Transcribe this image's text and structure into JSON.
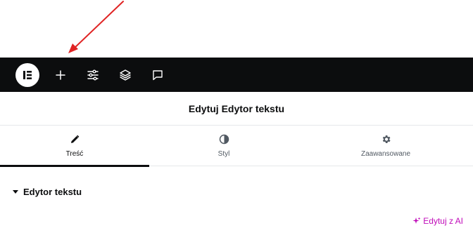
{
  "annotation": {
    "color": "#e02424",
    "type": "arrow"
  },
  "topbar": {
    "background": "#0c0d0e",
    "items": [
      {
        "name": "elementor-logo-icon"
      },
      {
        "name": "add-element-icon"
      },
      {
        "name": "site-settings-icon"
      },
      {
        "name": "structure-layers-icon"
      },
      {
        "name": "notes-icon"
      }
    ]
  },
  "panel": {
    "title": "Edytuj Edytor tekstu"
  },
  "tabs": [
    {
      "label": "Treść",
      "icon": "pencil-icon",
      "active": true
    },
    {
      "label": "Styl",
      "icon": "half-circle-icon",
      "active": false
    },
    {
      "label": "Zaawansowane",
      "icon": "gear-icon",
      "active": false
    }
  ],
  "section": {
    "label": "Edytor tekstu",
    "expanded": true
  },
  "ai_link": {
    "label": "Edytuj z AI",
    "color": "#c00bb9",
    "icon": "sparkle-icon"
  }
}
